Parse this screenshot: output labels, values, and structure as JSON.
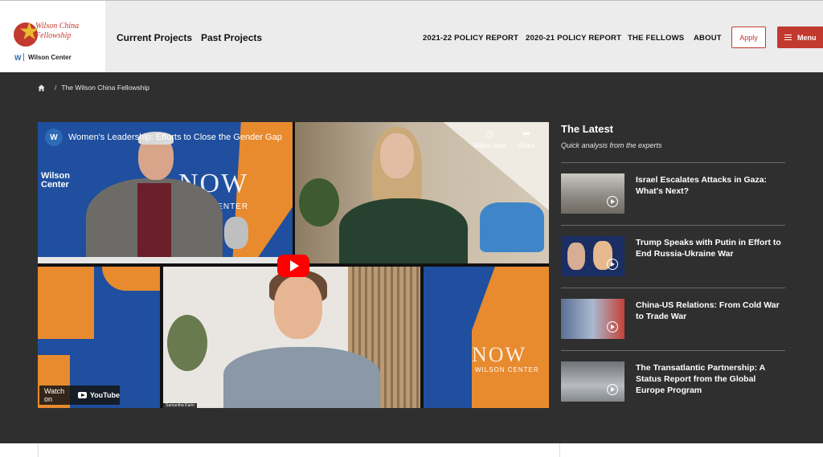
{
  "logo": {
    "line1": "Wilson China",
    "line2": "Fellowship",
    "wc_mark": "W",
    "wc_label": "Wilson Center"
  },
  "nav": {
    "main": [
      "Current Projects",
      "Past Projects"
    ],
    "sub": [
      "2021-22 POLICY REPORT",
      "2020-21 POLICY REPORT",
      "THE FELLOWS",
      "ABOUT"
    ],
    "apply": "Apply",
    "menu": "Menu"
  },
  "breadcrumb": {
    "separator": "/",
    "current": "The Wilson China Fellowship"
  },
  "video": {
    "logo_text": "W",
    "title": "Women's Leadership: Efforts to Close the Gender Gap",
    "watch_later": "Watch later",
    "share": "Share",
    "watch_on": "Watch on",
    "youtube": "YouTube",
    "panel1_brand": "Wilson Center",
    "now_big": "NOW",
    "center_text": "CENTER",
    "now_small": "NOW",
    "wilson_center_small": "WILSON CENTER",
    "name_tag": "Samantha Karin"
  },
  "latest": {
    "title": "The Latest",
    "subtitle": "Quick analysis from the experts",
    "items": [
      {
        "title": "Israel Escalates Attacks in Gaza: What's Next?"
      },
      {
        "title": "Trump Speaks with Putin in Effort to End Russia-Ukraine War"
      },
      {
        "title": "China-US Relations: From Cold War to Trade War"
      },
      {
        "title": "The Transatlantic Partnership: A Status Report from the Global Europe Program"
      }
    ]
  },
  "colors": {
    "brand_red": "#c2392f",
    "dark_bg": "#2f2f2f",
    "header_bg": "#ececec"
  }
}
